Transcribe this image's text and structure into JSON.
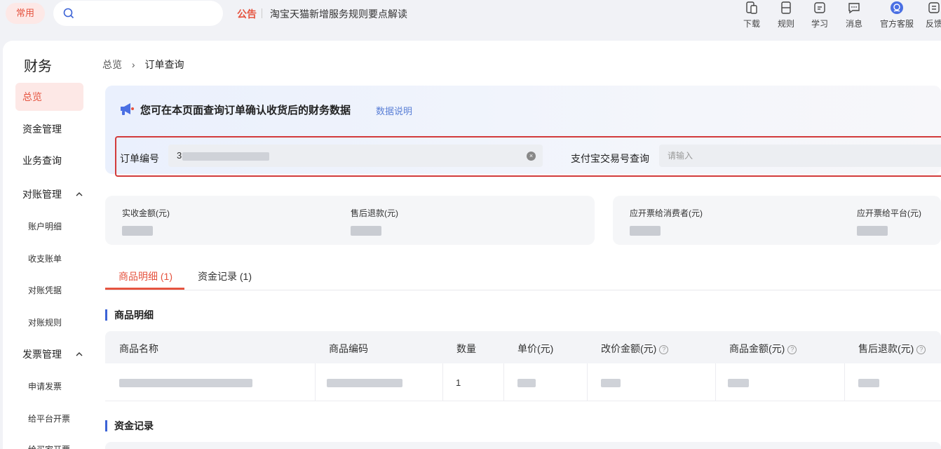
{
  "topbar": {
    "common_label": "常用",
    "notice_tag": "公告",
    "notice_text": "淘宝天猫新增服务规则要点解读",
    "tools": [
      {
        "label": "下载",
        "icon": "download-icon"
      },
      {
        "label": "规则",
        "icon": "rules-icon"
      },
      {
        "label": "学习",
        "icon": "learn-icon"
      },
      {
        "label": "消息",
        "icon": "message-icon"
      },
      {
        "label": "官方客服",
        "icon": "support-icon"
      },
      {
        "label": "反馈",
        "icon": "feedback-icon"
      }
    ]
  },
  "sidebar": {
    "title": "财务",
    "items": [
      {
        "label": "总览"
      },
      {
        "label": "资金管理"
      },
      {
        "label": "业务查询"
      },
      {
        "label": "对账管理"
      },
      {
        "label": "账户明细"
      },
      {
        "label": "收支账单"
      },
      {
        "label": "对账凭据"
      },
      {
        "label": "对账规则"
      },
      {
        "label": "发票管理"
      },
      {
        "label": "申请发票"
      },
      {
        "label": "给平台开票"
      },
      {
        "label": "给买家开票"
      }
    ]
  },
  "breadcrumb": {
    "root": "总览",
    "sep": "›",
    "current": "订单查询"
  },
  "banner": {
    "text": "您可在本页面查询订单确认收货后的财务数据",
    "link": "数据说明"
  },
  "query": {
    "order_label": "订单编号",
    "order_value_prefix": "3",
    "alipay_label": "支付宝交易号查询",
    "alipay_placeholder": "请输入"
  },
  "stats": [
    {
      "label": "实收金额(元)"
    },
    {
      "label": "售后退款(元)"
    },
    {
      "label": "应开票给消费者(元)"
    },
    {
      "label": "应开票给平台(元)"
    }
  ],
  "tabs": [
    {
      "label": "商品明细 (1)",
      "active": true
    },
    {
      "label": "资金记录 (1)",
      "active": false
    }
  ],
  "product_section": {
    "title": "商品明细",
    "headers": [
      "商品名称",
      "商品编码",
      "数量",
      "单价(元)",
      "改价金额(元)",
      "商品金额(元)",
      "售后退款(元)"
    ],
    "row": {
      "quantity": "1"
    }
  },
  "fund_section": {
    "title": "资金记录"
  },
  "colors": {
    "accent": "#e5533f",
    "link": "#5a7fd6",
    "highlight_border": "#d23b3b",
    "section_bar": "#3c63d6"
  }
}
